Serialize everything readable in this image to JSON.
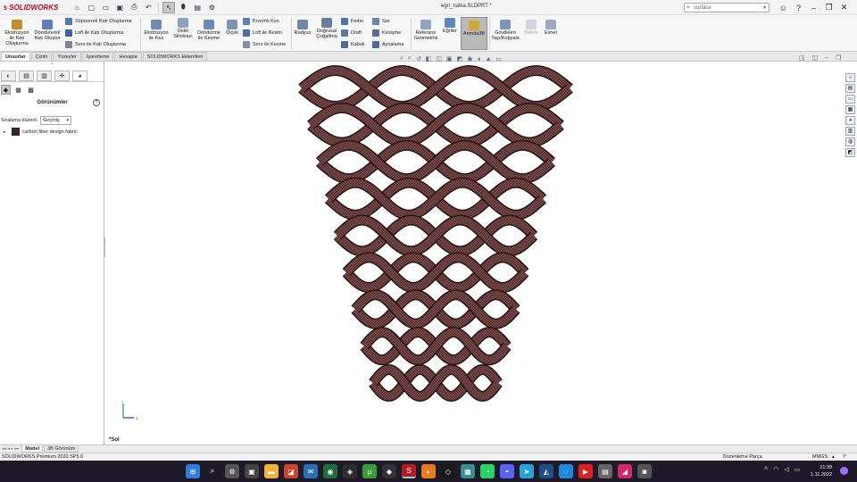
{
  "app": {
    "brand": "SOLIDWORKS",
    "document_title": "egri_halka.SLDPRT *",
    "search_placeholder": "surface"
  },
  "ribbon": {
    "extrude_boss": "Ekstrüzyon ile Katı Oluşturma",
    "revolve_boss": "Döndürerek Katı Oluştur",
    "sweep_boss": "Süpürerek Katı Oluşturma",
    "loft_boss": "Loft ile Katı Oluşturma",
    "boundary_boss": "Sınır ile Katı Oluşturma",
    "extrude_cut": "Ekstrüzyon ile Kes",
    "hole_wizard": "Delik Sihirbazı",
    "revolve_cut": "Döndürme ile Kesme",
    "scale": "Ölçek",
    "swept_cut": "Kıvrımlı Kes",
    "lofted_cut": "Loft ile Kesim",
    "boundary_cut": "Sınır ile Kesme",
    "fillet": "Radyus",
    "linear_pattern": "Doğrusal Çoğaltma",
    "rib": "Feder",
    "draft": "Draft",
    "shell": "Kabuk",
    "wrap": "Sar",
    "intersect": "Kesişme",
    "mirror": "Aynalama",
    "ref_geometry": "Referans Geometrisi",
    "curves": "Eğriler",
    "instant3d": "Anında3B",
    "move_copy_bodies": "Gövdeleri Taşı/Kopyala",
    "flex": "Belirle",
    "flex2": "Esnet"
  },
  "tabs": [
    "Unsurlar",
    "Çizim",
    "Yüzeyler",
    "İşaretleme",
    "Hesapla",
    "SOLIDWORKS Eklentileri"
  ],
  "panel": {
    "title": "Görünümler",
    "sort_label": "Sıralama düzeni:",
    "sort_value": "Geçmiş",
    "item": "carbon fiber design fabric"
  },
  "viewport": {
    "view_name": "*Sol",
    "triad_y": "Y",
    "triad_z": "Z"
  },
  "bottom_tabs": [
    "Model",
    "3B Görünüm"
  ],
  "status": {
    "product": "SOLIDWORKS Premium 2020 SP5.0",
    "mode": "Düzenleme Parça",
    "units": "MMGS",
    "help": "?"
  },
  "clock": {
    "time": "21:39",
    "date": "1.11.2022"
  },
  "colors": {
    "accent": "#d0021b",
    "model": "#7a4a4a",
    "taskbar": "#1f1a29"
  }
}
